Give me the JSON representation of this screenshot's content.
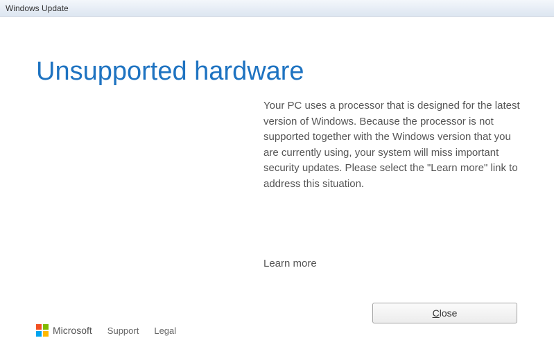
{
  "titlebar": {
    "title": "Windows Update"
  },
  "main": {
    "heading": "Unsupported hardware",
    "body": "Your PC uses a processor that is designed for the latest version of Windows. Because the processor is not supported together with the Windows version that you are currently using, your system will miss important security updates. Please select the \"Learn more\" link to address this situation.",
    "learn_more_label": "Learn more",
    "close_prefix": "",
    "close_key": "C",
    "close_suffix": "lose"
  },
  "footer": {
    "brand": "Microsoft",
    "support": "Support",
    "legal": "Legal"
  }
}
